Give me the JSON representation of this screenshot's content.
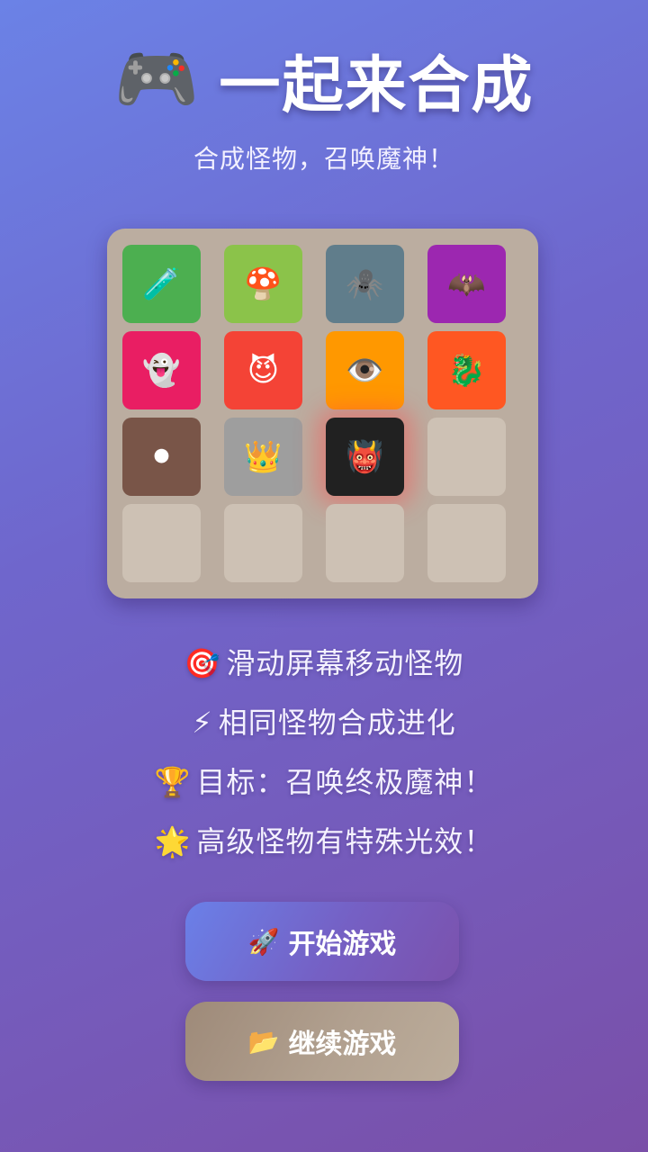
{
  "header": {
    "icon": "🎮",
    "icon_name": "gamepad-icon",
    "title": "一起来合成"
  },
  "subtitle": "合成怪物，召唤魔神！",
  "board": {
    "rows": 4,
    "cols": 4,
    "tiles": [
      {
        "emoji": "🧪",
        "name": "potion-icon",
        "color": "#4caf50"
      },
      {
        "emoji": "🍄",
        "name": "mushroom-icon",
        "color": "#8bc34a"
      },
      {
        "emoji": "🕷️",
        "name": "spider-icon",
        "color": "#607d8b"
      },
      {
        "emoji": "🦇",
        "name": "bat-icon",
        "color": "#9c27b0"
      },
      {
        "emoji": "👻",
        "name": "ghost-icon",
        "color": "#e91e63"
      },
      {
        "emoji": "😈",
        "name": "devil-icon",
        "color": "#f44336"
      },
      {
        "emoji": "👁️",
        "name": "eye-icon",
        "color": "#ff9800"
      },
      {
        "emoji": "🐉",
        "name": "dragon-icon",
        "color": "#ff5722"
      },
      {
        "emoji": "⚫",
        "name": "dark-orb-icon",
        "color": "#795548"
      },
      {
        "emoji": "👑",
        "name": "crown-icon",
        "color": "#9e9e9e"
      },
      {
        "emoji": "👹",
        "name": "demon-god-icon",
        "color": "#212121",
        "glow": true
      },
      null,
      null,
      null,
      null,
      null
    ]
  },
  "instructions": [
    {
      "icon": "🎯",
      "icon_name": "target-icon",
      "text": "滑动屏幕移动怪物"
    },
    {
      "icon": "⚡",
      "icon_name": "lightning-icon",
      "text": "相同怪物合成进化"
    },
    {
      "icon": "🏆",
      "icon_name": "trophy-icon",
      "text": "目标：召唤终极魔神！"
    },
    {
      "icon": "🌟",
      "icon_name": "star-icon",
      "text": "高级怪物有特殊光效！"
    }
  ],
  "buttons": {
    "start": {
      "icon": "🚀",
      "icon_name": "rocket-icon",
      "label": "开始游戏"
    },
    "continue": {
      "icon": "📂",
      "icon_name": "folder-icon",
      "label": "继续游戏"
    }
  }
}
